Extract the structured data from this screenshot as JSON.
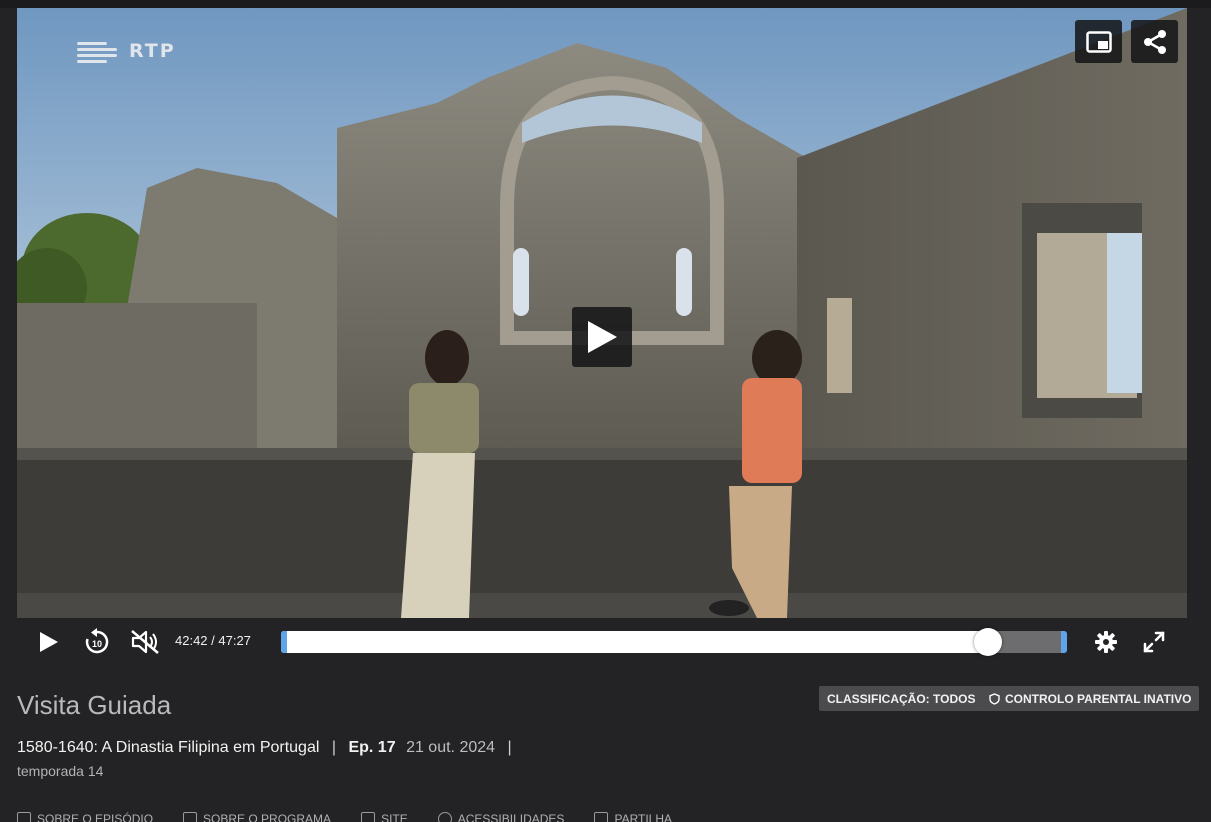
{
  "player": {
    "brand_logo": "RTP",
    "top_buttons": {
      "pip": {
        "icon": "picture-in-picture-icon"
      },
      "share": {
        "icon": "share-icon"
      }
    },
    "center_play": {
      "icon": "play-icon"
    },
    "controls": {
      "play": {
        "icon": "play-icon"
      },
      "rewind": {
        "icon": "rewind-10-icon",
        "label": "10"
      },
      "mute": {
        "icon": "muted-speaker-icon"
      },
      "time": "42:42 / 47:27",
      "progress_fraction": 0.8998,
      "settings": {
        "icon": "gear-icon"
      },
      "fullscreen": {
        "icon": "fullscreen-icon"
      }
    }
  },
  "info": {
    "title": "Visita Guiada",
    "badges": {
      "rating": "CLASSIFICAÇÃO: TODOS",
      "parental": "CONTROLO PARENTAL INATIVO"
    },
    "episode": {
      "name": "1580-1640: A Dinastia Filipina em Portugal",
      "separator": "|",
      "number": "Ep. 17",
      "date": "21 out. 2024",
      "trailing_separator": "|"
    },
    "season": "temporada 14"
  },
  "tabs": [
    {
      "label": "SOBRE O EPISÓDIO"
    },
    {
      "label": "SOBRE O PROGRAMA"
    },
    {
      "label": "SITE"
    },
    {
      "label": "ACESSIBILIDADES"
    },
    {
      "label": "PARTILHA"
    }
  ],
  "colors": {
    "background": "#232325",
    "progress_played": "#ffffff",
    "progress_track": "#6d6d70",
    "progress_edge": "#5fa3e8",
    "badge_bg": "#4b4b4e"
  }
}
